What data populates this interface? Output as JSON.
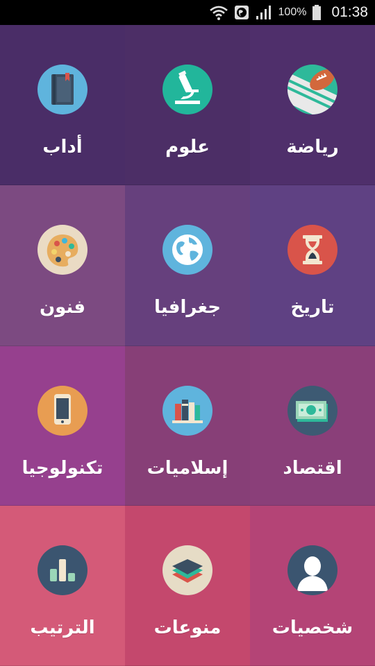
{
  "status_bar": {
    "battery": "100%",
    "time": "01:38"
  },
  "tiles": [
    {
      "label": "رياضة",
      "icon": "football-icon",
      "bg": "#4f2f6b",
      "icon_bg": "#2eb99a"
    },
    {
      "label": "علوم",
      "icon": "microscope-icon",
      "bg": "#4c2e66",
      "icon_bg": "#22b69b"
    },
    {
      "label": "أداب",
      "icon": "book-icon",
      "bg": "#4a2d67",
      "icon_bg": "#5fb4dd"
    },
    {
      "label": "تاريخ",
      "icon": "hourglass-icon",
      "bg": "#5f4183",
      "icon_bg": "#d9544a"
    },
    {
      "label": "جغرافيا",
      "icon": "globe-icon",
      "bg": "#66407d",
      "icon_bg": "#5fb4dd"
    },
    {
      "label": "فنون",
      "icon": "palette-icon",
      "bg": "#7c4a81",
      "icon_bg": "#eadbc4"
    },
    {
      "label": "اقتصاد",
      "icon": "money-icon",
      "bg": "#8a3f79",
      "icon_bg": "#3d5a73"
    },
    {
      "label": "إسلاميات",
      "icon": "books-icon",
      "bg": "#873f77",
      "icon_bg": "#5fb4dd"
    },
    {
      "label": "تكنولوجيا",
      "icon": "phone-icon",
      "bg": "#96408e",
      "icon_bg": "#e89d52"
    },
    {
      "label": "شخصيات",
      "icon": "person-icon",
      "bg": "#b44476",
      "icon_bg": "#3b5570"
    },
    {
      "label": "منوعات",
      "icon": "layers-icon",
      "bg": "#c4486d",
      "icon_bg": "#e6dcc6"
    },
    {
      "label": "الترتيب",
      "icon": "bar-chart-icon",
      "bg": "#d45a78",
      "icon_bg": "#3b5570"
    }
  ]
}
